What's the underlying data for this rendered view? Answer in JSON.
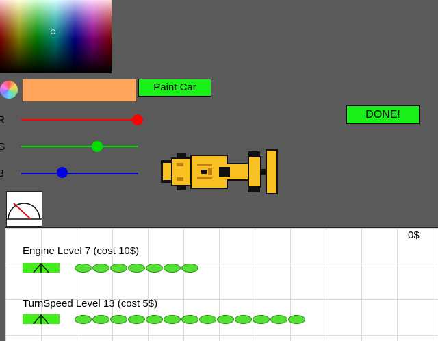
{
  "colors": {
    "background": "#5a5a5a",
    "selected_color": "#ffa55c",
    "button": "#1af01a",
    "car_body": "#f8c020"
  },
  "paint": {
    "button_label": "Paint Car",
    "done_label": "DONE!"
  },
  "sliders": [
    {
      "label": "R",
      "color": "#ff0000",
      "value": 1.0
    },
    {
      "label": "G",
      "color": "#00e000",
      "value": 0.65
    },
    {
      "label": "B",
      "color": "#0000e0",
      "value": 0.35
    }
  ],
  "money": "0$",
  "upgrades": [
    {
      "label": "Engine Level 7 (cost 10$)",
      "level": 7
    },
    {
      "label": "TurnSpeed Level 13 (cost 5$)",
      "level": 13
    }
  ]
}
